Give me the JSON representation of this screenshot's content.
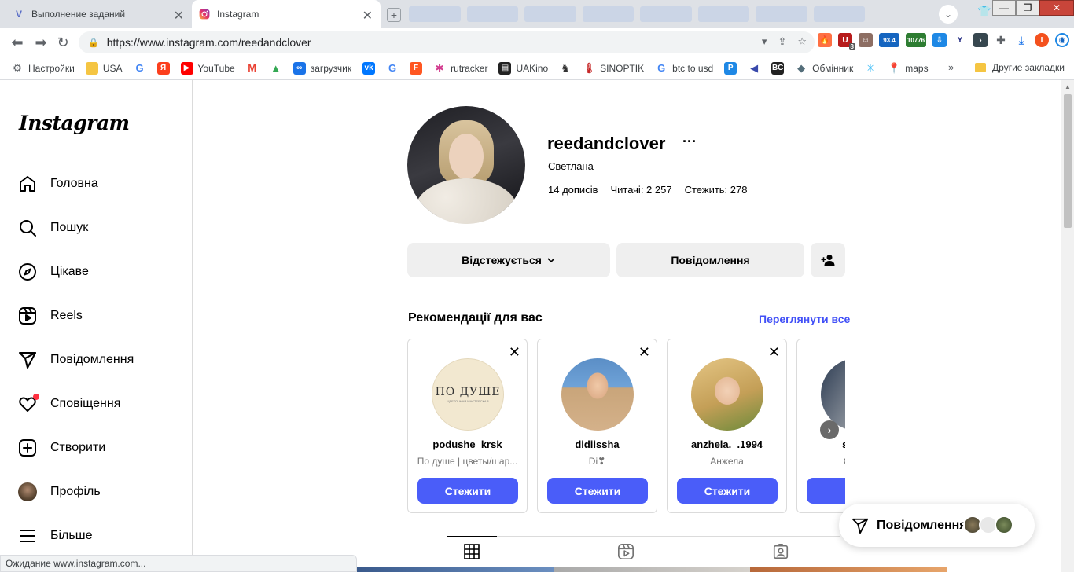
{
  "browser": {
    "tabs": [
      {
        "title": "Выполнение заданий"
      },
      {
        "title": "Instagram"
      }
    ],
    "url": "https://www.instagram.com/reedandclover",
    "extension_badges": {
      "ext1": "8",
      "ext2": "93.4",
      "ext3": "10776"
    },
    "profile_initial": "I",
    "bookmarks": [
      {
        "label": "Настройки",
        "icon": "gear-icon",
        "color": "#5f6368"
      },
      {
        "label": "USA",
        "icon": "folder-icon",
        "color": "#f5c542"
      },
      {
        "label": "",
        "icon": "google-icon",
        "color": "#4285f4"
      },
      {
        "label": "",
        "icon": "yandex-icon",
        "color": "#fc3f1d"
      },
      {
        "label": "YouTube",
        "icon": "youtube-icon",
        "color": "#ff0000"
      },
      {
        "label": "",
        "icon": "gmail-icon",
        "color": "#ea4335"
      },
      {
        "label": "",
        "icon": "drive-icon",
        "color": "#34a853"
      },
      {
        "label": "загрузчик",
        "icon": "infinity-icon",
        "color": "#1a73e8"
      },
      {
        "label": "",
        "icon": "vk-icon",
        "color": "#0077ff"
      },
      {
        "label": "",
        "icon": "translate-icon",
        "color": "#4285f4"
      },
      {
        "label": "",
        "icon": "f-icon",
        "color": "#ff5722"
      },
      {
        "label": "rutracker",
        "icon": "rutracker-icon",
        "color": "#d33c8f"
      },
      {
        "label": "UAKino",
        "icon": "uakino-icon",
        "color": "#222222"
      },
      {
        "label": "",
        "icon": "chess-icon",
        "color": "#333333"
      },
      {
        "label": "SINOPTIK",
        "icon": "thermometer-icon",
        "color": "#c62828"
      },
      {
        "label": "btc to usd",
        "icon": "google-icon",
        "color": "#4285f4"
      },
      {
        "label": "",
        "icon": "p-icon",
        "color": "#1e88e5"
      },
      {
        "label": "",
        "icon": "arrow-icon",
        "color": "#3949ab"
      },
      {
        "label": "",
        "icon": "bc-icon",
        "color": "#222222"
      },
      {
        "label": "Обмінник",
        "icon": "diamond-icon",
        "color": "#546e7a"
      },
      {
        "label": "",
        "icon": "snowflake-icon",
        "color": "#29b6f6"
      },
      {
        "label": "maps",
        "icon": "maps-icon",
        "color": "#34a853"
      }
    ],
    "bookmarks_overflow": "»",
    "other_bookmarks": "Другие закладки",
    "status_text": "Ожидание www.instagram.com..."
  },
  "sidebar": {
    "logo": "Instagram",
    "items": [
      {
        "label": "Головна",
        "icon": "home-icon"
      },
      {
        "label": "Пошук",
        "icon": "search-icon"
      },
      {
        "label": "Цікаве",
        "icon": "compass-icon"
      },
      {
        "label": "Reels",
        "icon": "reels-icon"
      },
      {
        "label": "Повідомлення",
        "icon": "messenger-icon"
      },
      {
        "label": "Сповіщення",
        "icon": "heart-icon"
      },
      {
        "label": "Створити",
        "icon": "plus-square-icon"
      },
      {
        "label": "Профіль",
        "icon": "profile-avatar"
      },
      {
        "label": "Більше",
        "icon": "menu-icon"
      }
    ]
  },
  "profile": {
    "username": "reedandclover",
    "more": "···",
    "full_name": "Светлана",
    "posts": "14 дописів",
    "followers": "Читачі: 2 257",
    "following": "Стежить: 278",
    "following_button": "Відстежується",
    "message_button": "Повідомлення"
  },
  "recommendations": {
    "title": "Рекомендації для вас",
    "see_all": "Переглянути все",
    "cards": [
      {
        "username": "podushe_krsk",
        "subtitle": "По душе | цветы/шар...",
        "button": "Стежити",
        "avatar_text": "ПО ДУШЕ",
        "avatar_subtext": "ЦВЕТОЧНАЯ МАСТЕРСКАЯ"
      },
      {
        "username": "didiissha",
        "subtitle": "Di❣",
        "button": "Стежити"
      },
      {
        "username": "anzhela._.1994",
        "subtitle": "Анжела",
        "button": "Стежити"
      },
      {
        "username": "svetla",
        "subtitle": "Светл",
        "button": "Ст"
      }
    ]
  },
  "floating": {
    "messages_label": "Повідомлення"
  },
  "colors": {
    "accent_blue": "#4a5df9",
    "link_blue": "#4150f7",
    "notification_dot": "#ff3040"
  }
}
